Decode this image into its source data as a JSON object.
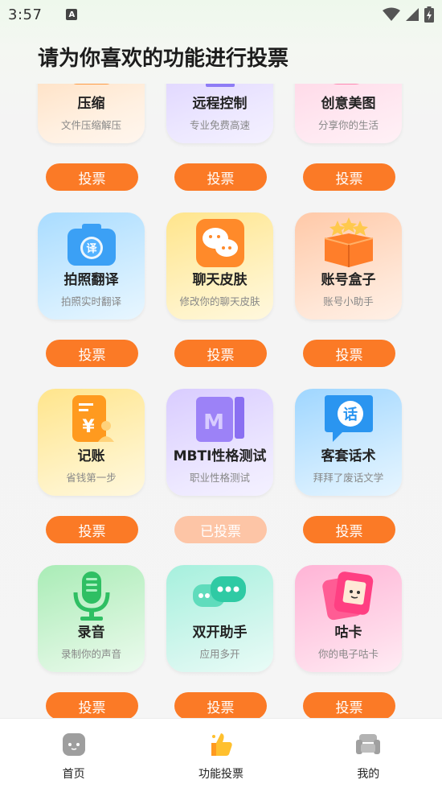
{
  "status": {
    "time": "3:57"
  },
  "header": {
    "title": "请为你喜欢的功能进行投票"
  },
  "features": [
    {
      "name": "压缩",
      "desc": "文件压缩解压",
      "vote": "投票",
      "voted": false,
      "color": "orange",
      "icon": "archive-icon"
    },
    {
      "name": "远程控制",
      "desc": "专业免费高速",
      "vote": "投票",
      "voted": false,
      "color": "purple",
      "icon": "monitor-icon"
    },
    {
      "name": "创意美图",
      "desc": "分享你的生活",
      "vote": "投票",
      "voted": false,
      "color": "pink",
      "icon": "sparkle-image-icon"
    },
    {
      "name": "拍照翻译",
      "desc": "拍照实时翻译",
      "vote": "投票",
      "voted": false,
      "color": "blue",
      "icon": "camera-translate-icon"
    },
    {
      "name": "聊天皮肤",
      "desc": "修改你的聊天皮肤",
      "vote": "投票",
      "voted": false,
      "color": "yellow",
      "icon": "chat-bubbles-icon"
    },
    {
      "name": "账号盒子",
      "desc": "账号小助手",
      "vote": "投票",
      "voted": false,
      "color": "peach",
      "icon": "star-box-icon"
    },
    {
      "name": "记账",
      "desc": "省钱第一步",
      "vote": "投票",
      "voted": false,
      "color": "yellow",
      "icon": "yen-receipt-icon"
    },
    {
      "name": "MBTI性格测试",
      "desc": "职业性格测试",
      "vote": "已投票",
      "voted": true,
      "color": "purple",
      "icon": "mbti-book-icon"
    },
    {
      "name": "客套话术",
      "desc": "拜拜了废话文学",
      "vote": "投票",
      "voted": false,
      "color": "sky",
      "icon": "speech-bubble-icon"
    },
    {
      "name": "录音",
      "desc": "录制你的声音",
      "vote": "投票",
      "voted": false,
      "color": "green",
      "icon": "microphone-icon"
    },
    {
      "name": "双开助手",
      "desc": "应用多开",
      "vote": "投票",
      "voted": false,
      "color": "teal",
      "icon": "double-chat-icon"
    },
    {
      "name": "咕卡",
      "desc": "你的电子咕卡",
      "vote": "投票",
      "voted": false,
      "color": "rose",
      "icon": "photo-card-icon"
    }
  ],
  "glyphs": {
    "translate": "译",
    "yen": "¥",
    "mbti": "M",
    "speech": "话"
  },
  "tabs": [
    {
      "label": "首页",
      "icon": "home-face-icon"
    },
    {
      "label": "功能投票",
      "icon": "thumbs-up-icon"
    },
    {
      "label": "我的",
      "icon": "profile-sofa-icon"
    }
  ],
  "colors": {
    "accent": "#fb7a26",
    "voted": "#fdc5a6"
  }
}
